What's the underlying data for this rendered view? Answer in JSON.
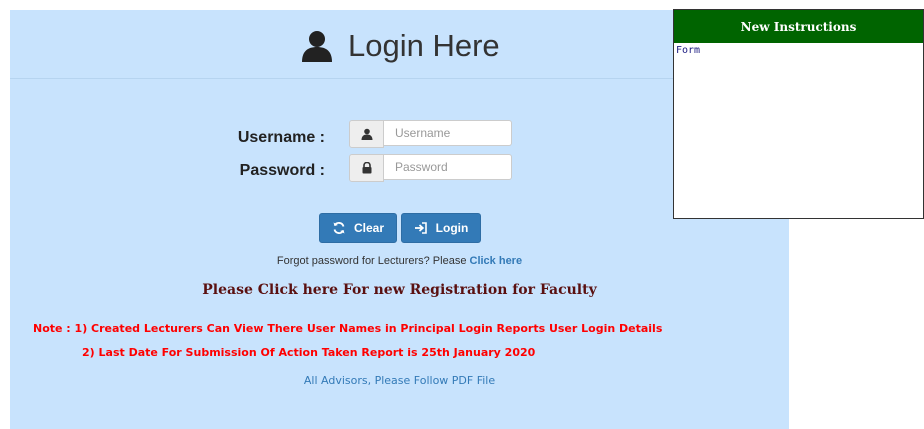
{
  "login": {
    "title": "Login Here",
    "username_label": "Username :",
    "password_label": "Password :",
    "username_placeholder": "Username",
    "password_placeholder": "Password",
    "clear_label": "Clear",
    "login_label": "Login",
    "forgot_text": "Forgot password for Lecturers? Please ",
    "forgot_link": "Click here",
    "registration_text": "Please Click here For new Registration for Faculty",
    "note_line1": "Note : 1) Created Lecturers Can View There User Names in Principal Login Reports User Login Details",
    "note_line2": "2) Last Date For Submission Of Action Taken Report is 25th January 2020",
    "advisors_text": "All Advisors, Please Follow PDF File"
  },
  "instructions": {
    "title": "New Instructions",
    "body": "Form"
  },
  "colors": {
    "panel_bg": "#c8e3fd",
    "button": "#337ab7",
    "instructions_header": "#006400",
    "note": "#ff0000"
  },
  "icons": [
    "user-icon",
    "lock-icon",
    "refresh-icon",
    "sign-in-icon"
  ]
}
